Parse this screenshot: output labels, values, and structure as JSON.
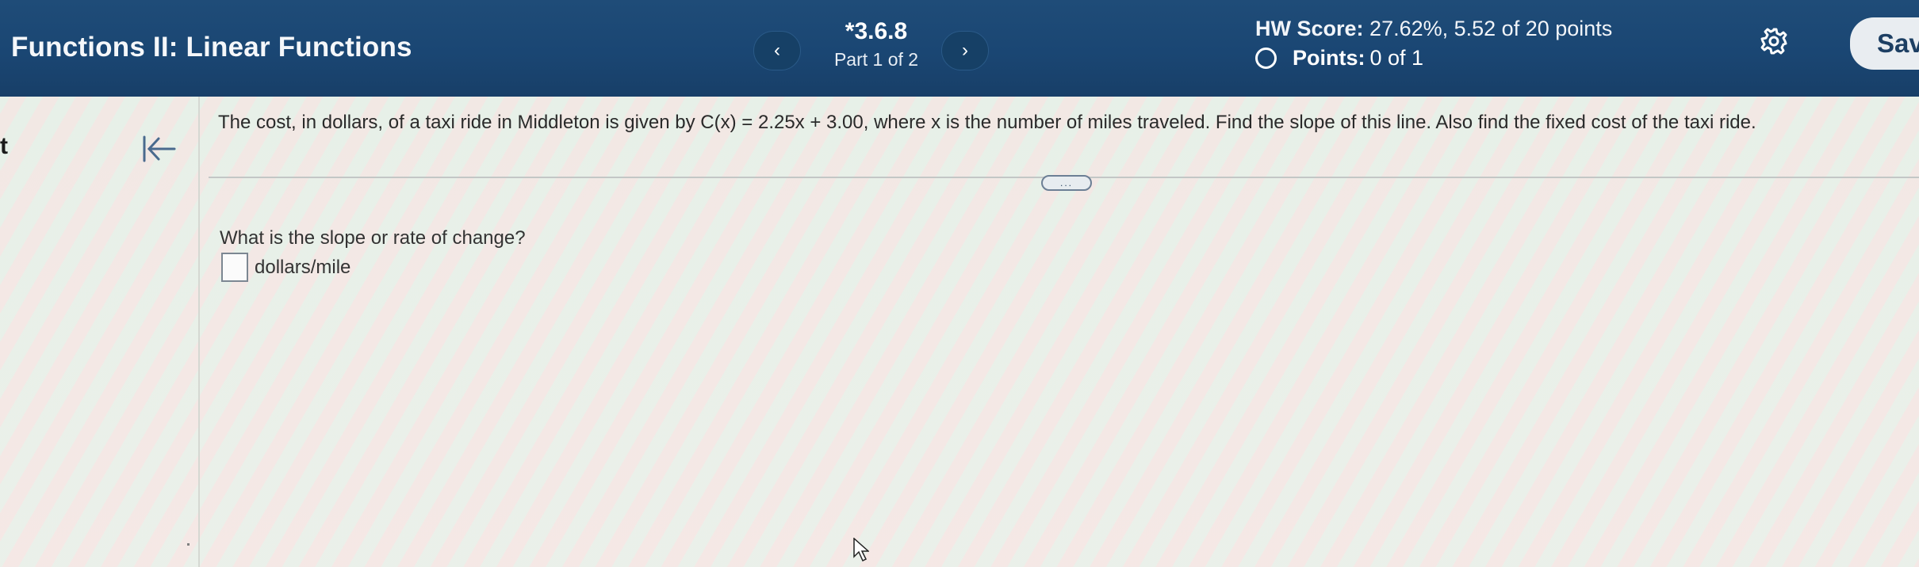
{
  "header": {
    "assignment_title": "Functions II: Linear Functions",
    "question_number": "*3.6.8",
    "part": "Part 1 of 2",
    "prev_label": "‹",
    "next_label": "›",
    "hw_score_label": "HW Score:",
    "hw_score_value": "27.62%, 5.52 of 20 points",
    "points_label": "Points:",
    "points_value": "0 of 1",
    "save_label": "Sav",
    "icons": {
      "prev": "chevron-left-icon",
      "next": "chevron-right-icon",
      "points_status": "circle-icon",
      "settings": "gear-icon"
    }
  },
  "sidebar": {
    "edge_text": "t",
    "collapse_icon": "collapse-left-icon"
  },
  "question": {
    "text": "The cost, in dollars, of a taxi ride in Middleton is given by C(x) = 2.25x + 3.00, where x is the number of miles traveled. Find the slope of this line. Also find the fixed cost of the taxi ride.",
    "more_label": "..."
  },
  "answer": {
    "prompt": "What is the slope or rate of change?",
    "input_value": "",
    "unit": "dollars/mile"
  },
  "colors": {
    "header_bg": "#1c4774",
    "header_text": "#ffffff",
    "save_button_bg": "#e9edf1",
    "save_button_text": "#1d3f63"
  }
}
